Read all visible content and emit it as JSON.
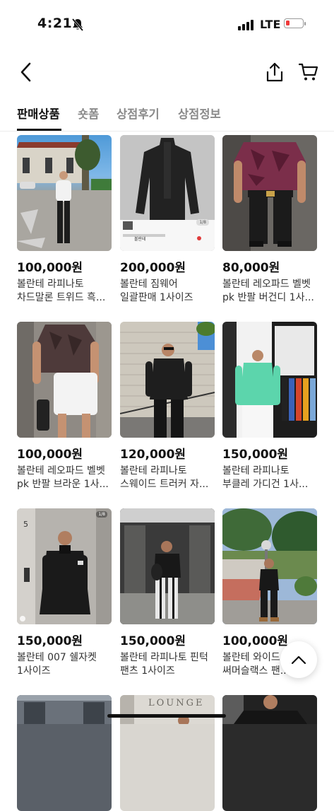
{
  "status_bar": {
    "time": "4:21",
    "network": "LTE"
  },
  "nav": {
    "back_icon": "chevron-left-icon",
    "share_icon": "share-icon",
    "cart_icon": "cart-icon"
  },
  "tabs": [
    {
      "label": "판매상품",
      "active": true
    },
    {
      "label": "숏폼",
      "active": false
    },
    {
      "label": "상점후기",
      "active": false
    },
    {
      "label": "상점정보",
      "active": false
    }
  ],
  "products": [
    {
      "price": "100,000원",
      "title": "볼란테 라피나토 차드말론 트위드 흑..."
    },
    {
      "price": "200,000원",
      "title": "볼란테 짐웨어 일괄판매 1사이즈"
    },
    {
      "price": "80,000원",
      "title": "볼란테 레오파드 벨벳 pk 반팔 버건디 1사..."
    },
    {
      "price": "100,000원",
      "title": "볼란테 레오파드 벨벳 pk 반팔 브라운 1사..."
    },
    {
      "price": "120,000원",
      "title": "볼란테 라피나토 스웨이드 트러커 자..."
    },
    {
      "price": "150,000원",
      "title": "볼란테 라피나토 부클레 가디건 1사..."
    },
    {
      "price": "150,000원",
      "title": "볼란테 007 쉘자켓 1사이즈"
    },
    {
      "price": "150,000원",
      "title": "볼란테 라피나토 핀턱 팬츠 1사이즈"
    },
    {
      "price": "100,000원",
      "title": "볼란테 와이드 써머슬랙스 팬..."
    }
  ],
  "thumb2_overlay": {
    "page": "1/8",
    "seller": "볼란테"
  },
  "thumb7_overlay": {
    "badge": "1/8",
    "door_number": "5"
  },
  "thumb12_overlay": {
    "sign": "LOUNGE"
  },
  "colors": {
    "accent": "#111111",
    "battery_low": "#f03a3a"
  }
}
